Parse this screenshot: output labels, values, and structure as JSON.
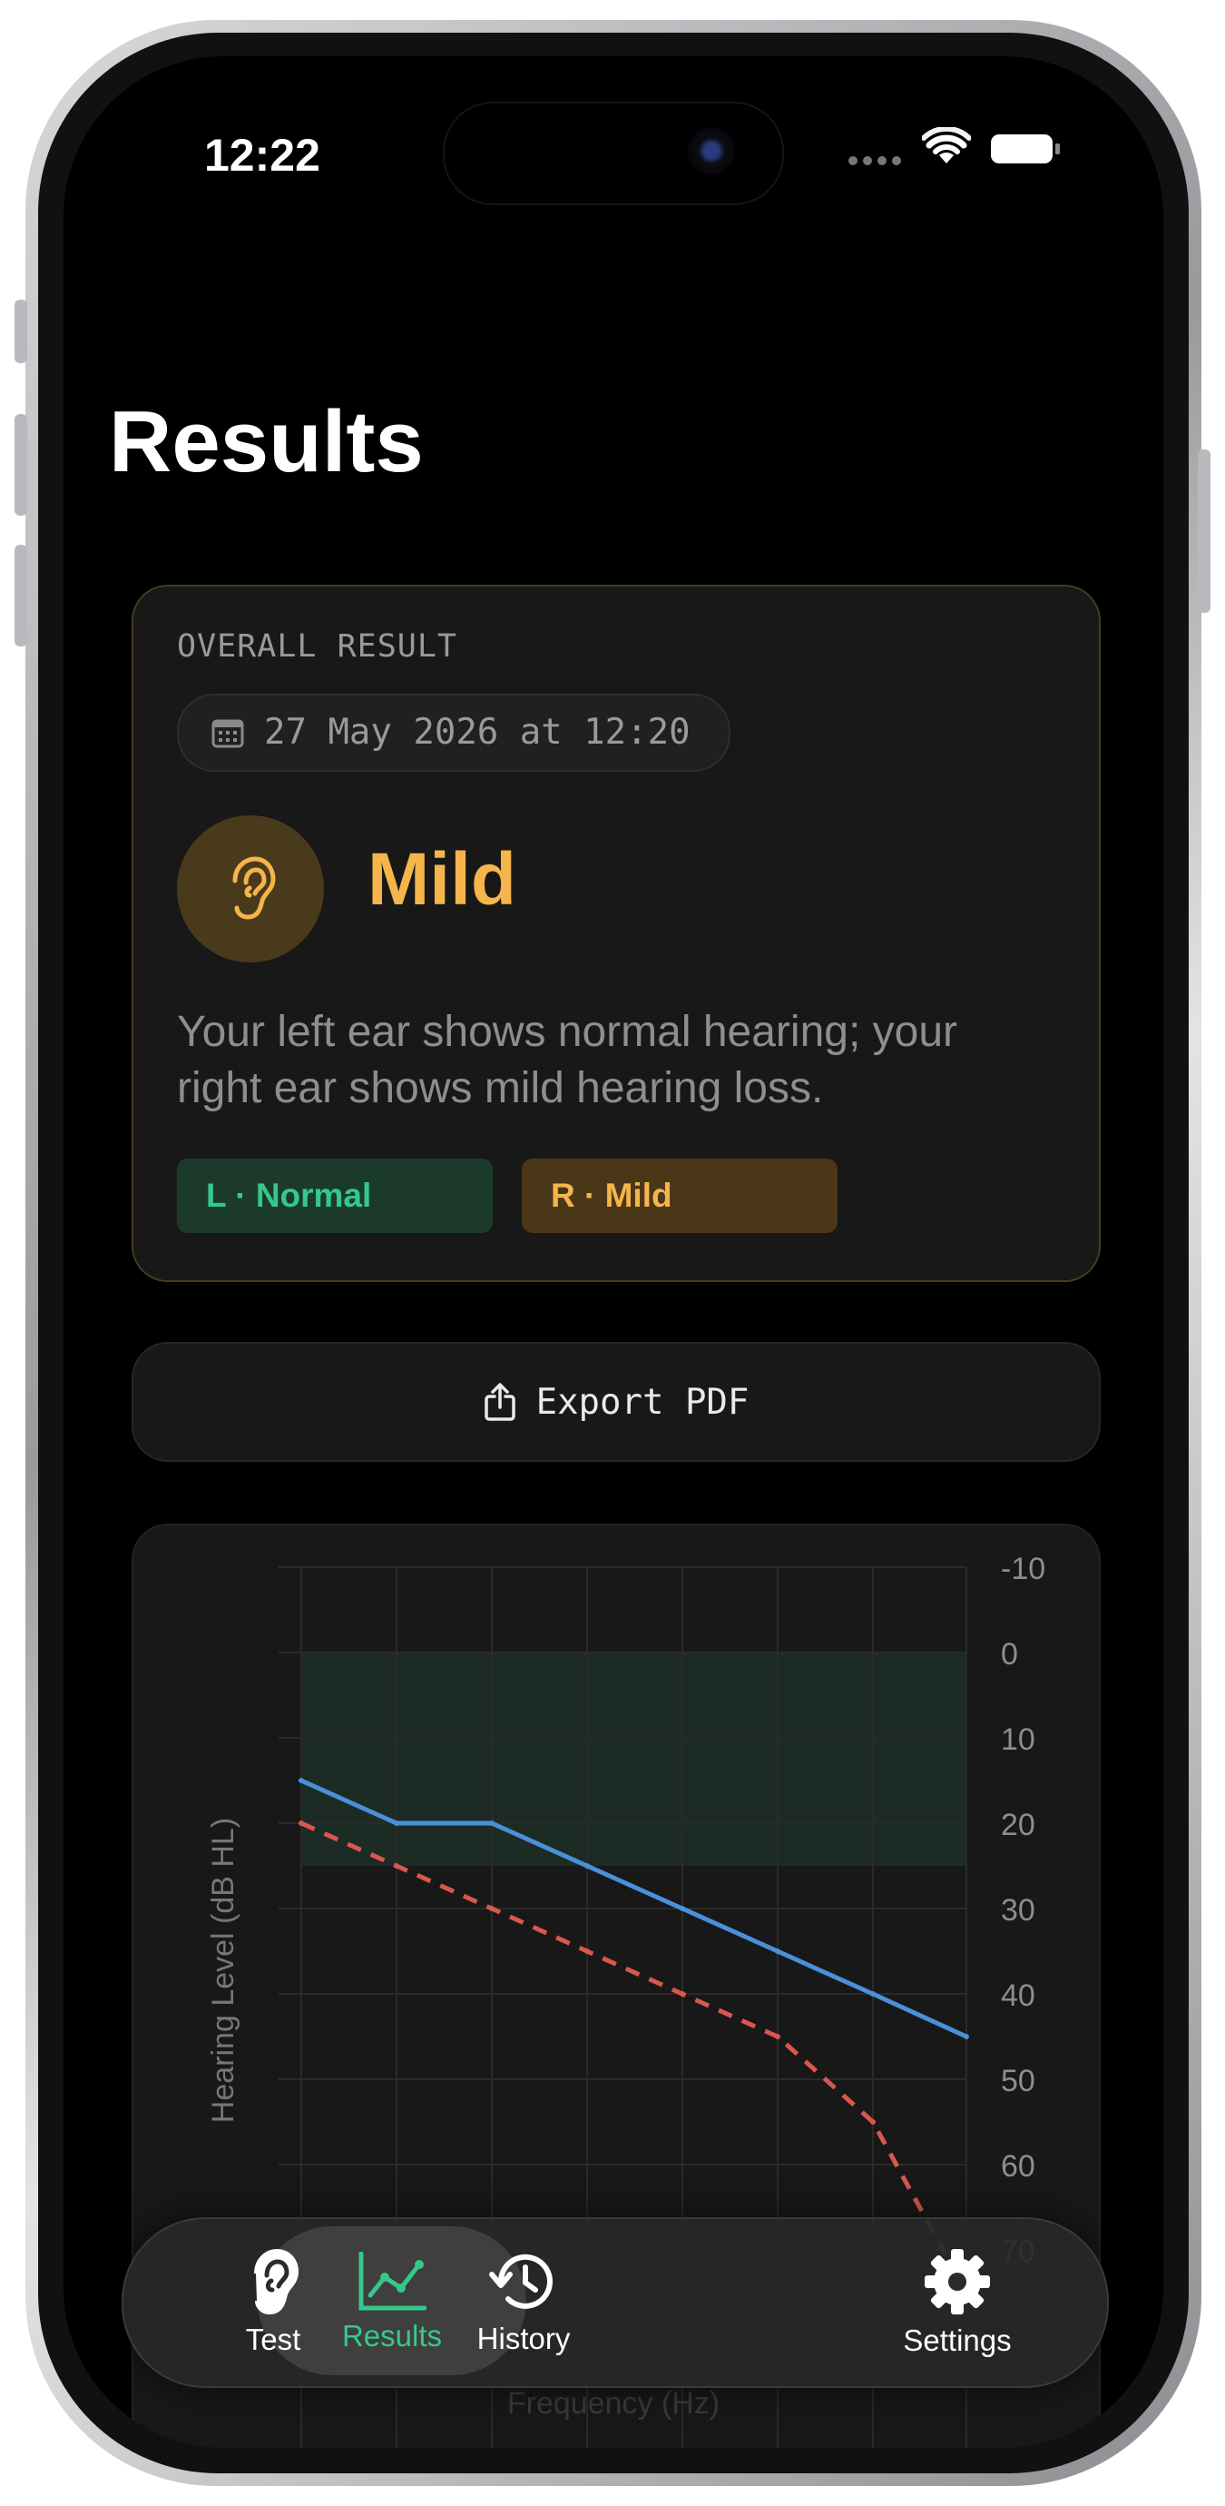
{
  "status_bar": {
    "time": "12:22"
  },
  "page": {
    "title": "Results"
  },
  "summary": {
    "overall_label": "OVERALL RESULT",
    "date": "27 May 2026 at 12:20",
    "classification": "Mild",
    "description": "Your left ear shows normal hearing; your right ear shows mild hearing loss.",
    "left_chip": "L · Normal",
    "right_chip": "R · Mild"
  },
  "export": {
    "label": "Export PDF"
  },
  "tabs": [
    {
      "label": "Test",
      "icon": "ear-icon"
    },
    {
      "label": "Results",
      "icon": "chart-icon",
      "selected": true
    },
    {
      "label": "History",
      "icon": "history-icon"
    },
    {
      "label": "Settings",
      "icon": "gear-icon"
    }
  ],
  "colors": {
    "accent_green": "#34c98a",
    "mild_orange": "#f5b54a",
    "left_ear_line": "#4a90d9",
    "right_ear_line": "#d9574f"
  },
  "chart_data": {
    "type": "line",
    "ylabel": "Hearing Level (dB HL)",
    "xlabel": "Frequency (Hz)",
    "y_ticks": [
      -10,
      0,
      10,
      20,
      30,
      40,
      50,
      60,
      70
    ],
    "ylim": [
      -10,
      70
    ],
    "y_inverted": true,
    "normal_band": [
      0,
      25
    ],
    "grid": true,
    "x_index": [
      0,
      1,
      2,
      3,
      4,
      5,
      6,
      7
    ],
    "series": [
      {
        "values": [
          15,
          20,
          20,
          25,
          30,
          35,
          40,
          45
        ],
        "color": "#4a90d9",
        "style": "solid"
      },
      {
        "values": [
          20,
          25,
          30,
          35,
          40,
          45,
          55,
          75
        ],
        "color": "#d9574f",
        "style": "dashed"
      }
    ]
  }
}
